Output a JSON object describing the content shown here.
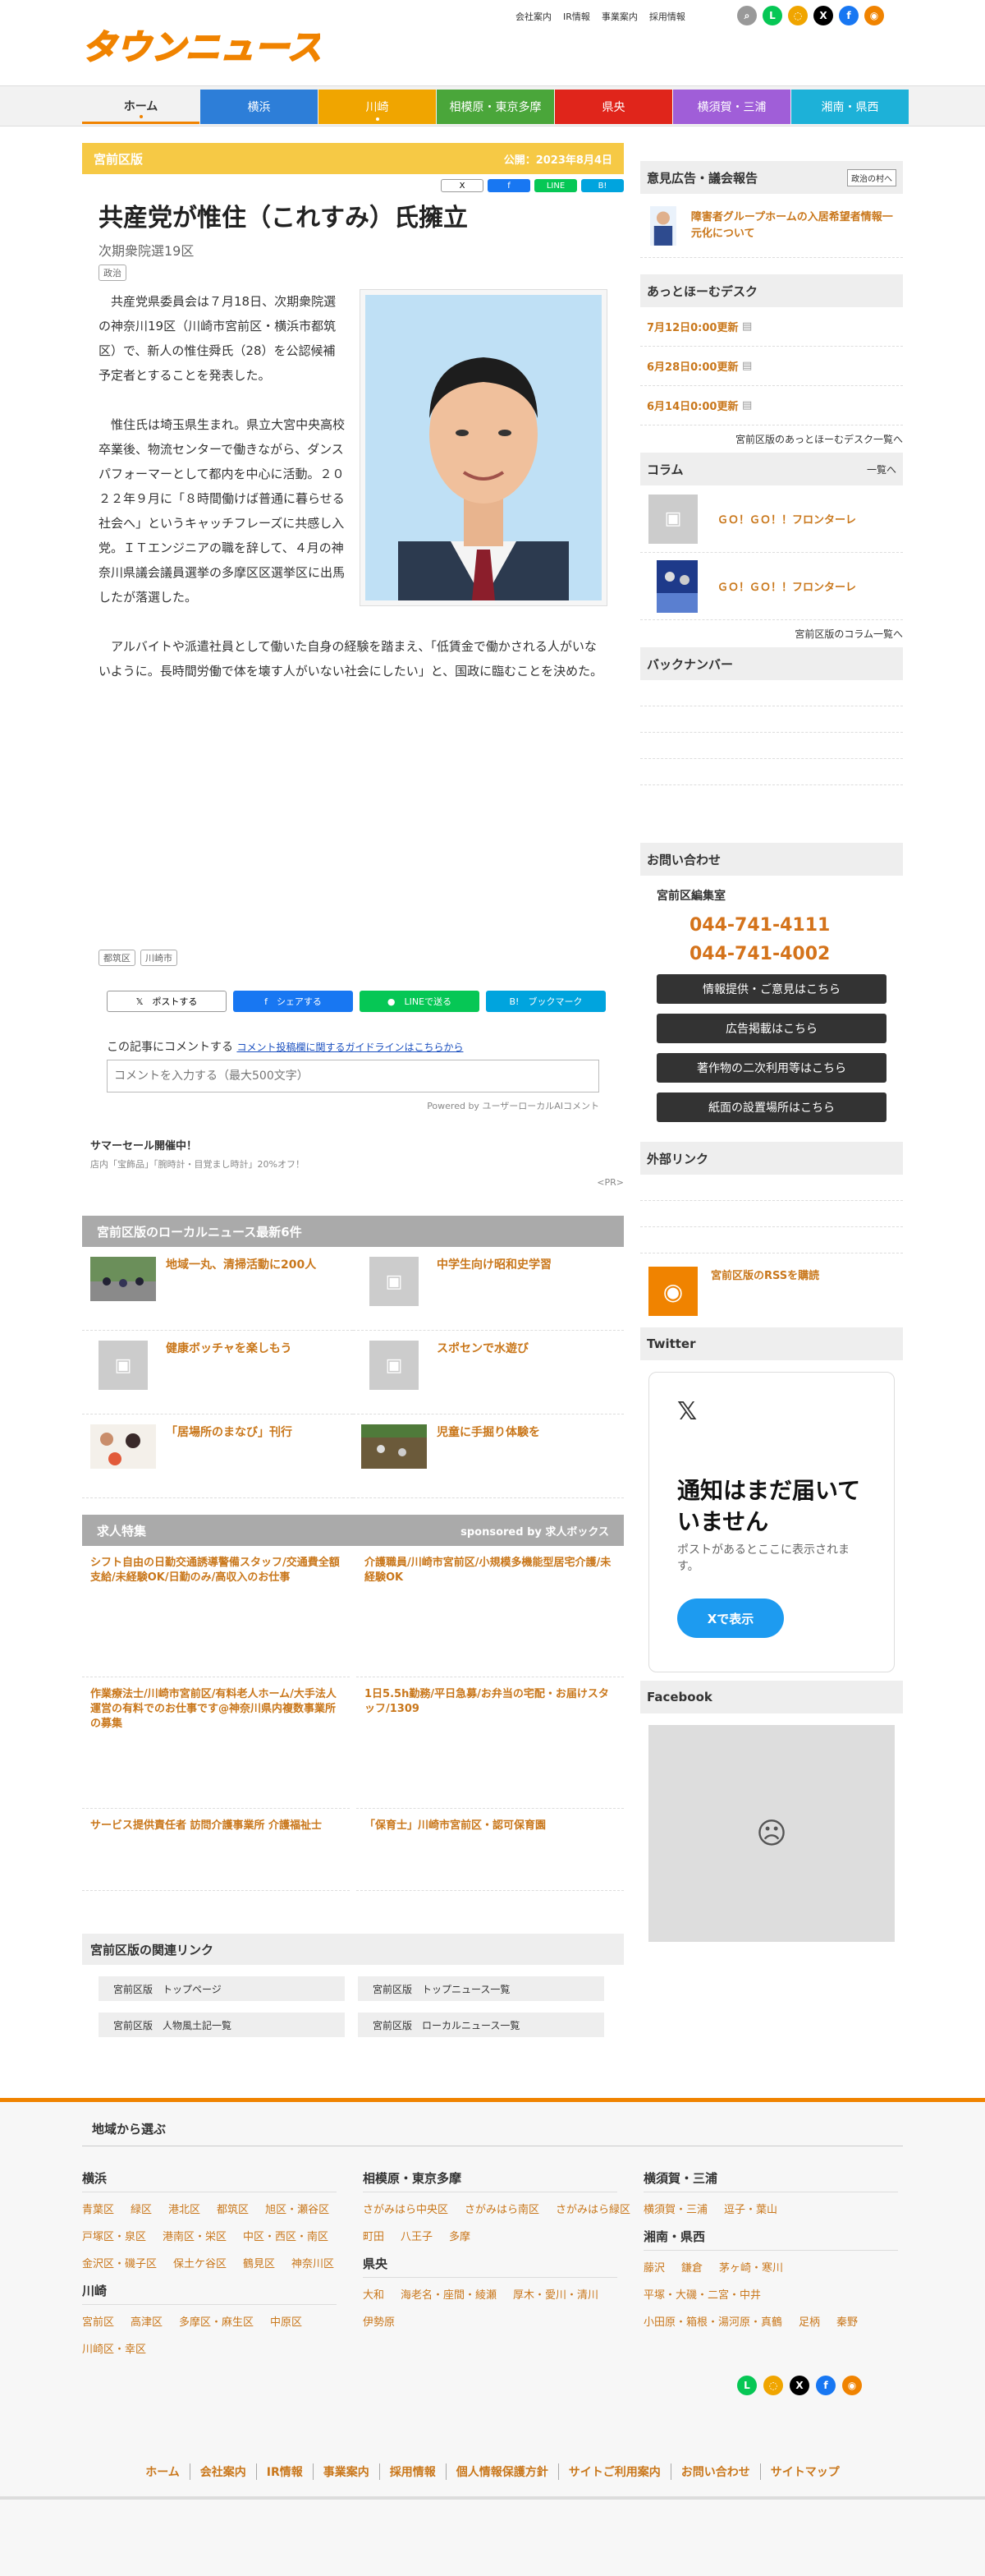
{
  "header": {
    "logo": "タウンニュース",
    "top_links": [
      "会社案内",
      "IR情報",
      "事業案内",
      "採用情報"
    ],
    "icons": [
      "search-icon",
      "line-icon",
      "note-icon",
      "x-icon",
      "facebook-icon",
      "rss-icon"
    ]
  },
  "nav": {
    "items": [
      {
        "label": "ホーム",
        "color": "#f2f2f2"
      },
      {
        "label": "横浜",
        "color": "#2d7ed8"
      },
      {
        "label": "川崎",
        "color": "#f0a500"
      },
      {
        "label": "相模原・東京多摩",
        "color": "#4aa63a"
      },
      {
        "label": "県央",
        "color": "#e0251b"
      },
      {
        "label": "横須賀・三浦",
        "color": "#a05ed8"
      },
      {
        "label": "湘南・県西",
        "color": "#1db1d8"
      }
    ]
  },
  "article": {
    "edition": "宮前区版",
    "date": "公開：2023年8月4日",
    "share_mini": [
      "X",
      "f",
      "LINE",
      "B!"
    ],
    "title": "共産党が惟住（これすみ）氏擁立",
    "subtitle": "次期衆院選19区",
    "category": "政治",
    "paragraphs": [
      "共産党県委員会は７月18日、次期衆院選の神奈川19区（川崎市宮前区・横浜市都筑区）で、新人の惟住舜氏（28）を公認候補予定者とすることを発表した。",
      "惟住氏は埼玉県生まれ。県立大宮中央高校卒業後、物流センターで働きながら、ダンスパフォーマーとして都内を中心に活動。２０２２年９月に「８時間働けば普通に暮らせる社会へ」というキャッチフレーズに共感し入党。ＩＴエンジニアの職を辞して、４月の神奈川県議会議員選挙の多摩区区選挙区に出馬したが落選した。",
      "アルバイトや派遣社員として働いた自身の経験を踏まえ、「低賃金で働かされる人がいないように。長時間労働で体を壊す人がいない社会にしたい」と、国政に臨むことを決めた。"
    ],
    "tags": [
      "都筑区",
      "川崎市"
    ],
    "share_buttons": [
      "ポストする",
      "シェアする",
      "LINEで送る",
      "ブックマーク"
    ],
    "comment_label": "この記事にコメントする",
    "comment_link": "コメント投稿欄に関するガイドラインはこちらから",
    "comment_placeholder": "コメントを入力する（最大500文字）",
    "powered": "Powered by ユーザーローカルAIコメント"
  },
  "promo": {
    "title": "サマーセール開催中！",
    "text": "店内「宝飾品」「腕時計・目覚まし時計」20%オフ！",
    "pr": "<PR>"
  },
  "local_news": {
    "heading": "宮前区版のローカルニュース最新6件",
    "items": [
      {
        "title": "地域一丸、清掃活動に200人",
        "img": true
      },
      {
        "title": "中学生向け昭和史学習",
        "img": false
      },
      {
        "title": "健康ボッチャを楽しもう",
        "img": false
      },
      {
        "title": "スポセンで水遊び",
        "img": false
      },
      {
        "title": "「居場所のまなび」刊行",
        "img": true
      },
      {
        "title": "児童に手掘り体験を",
        "img": true
      }
    ]
  },
  "jobs": {
    "heading": "求人特集",
    "sponsor": "sponsored by 求人ボックス",
    "items": [
      "シフト自由の日勤交通誘導警備スタッフ/交通費全額支給/未経験OK/日勤のみ/高収入のお仕事",
      "介護職員/川崎市宮前区/小規模多機能型居宅介護/未経験OK",
      "作業療法士/川崎市宮前区/有料老人ホーム/大手法人運営の有料でのお仕事です@神奈川県内複数事業所の募集",
      "1日5.5h勤務/平日急募/お弁当の宅配・お届けスタッフ/1309",
      "サービス提供責任者 訪問介護事業所 介護福祉士",
      "「保育士」川崎市宮前区・認可保育園"
    ]
  },
  "related": {
    "heading": "宮前区版の関連リンク",
    "links": [
      "宮前区版　トップページ",
      "宮前区版　トップニュース一覧",
      "宮前区版　人物風土記一覧",
      "宮前区版　ローカルニュース一覧"
    ]
  },
  "sidebar": {
    "opinion_heading": "意見広告・議会報告",
    "opinion_badge": "政治の村へ",
    "opinion_text": "障害者グループホームの入居希望者情報一元化について",
    "athome_heading": "あっとほーむデスク",
    "athome_items": [
      "7月12日0:00更新",
      "6月28日0:00更新",
      "6月14日0:00更新"
    ],
    "athome_more": "宮前区版のあっとほーむデスク一覧へ",
    "column_heading": "コラム",
    "column_more_top": "一覧へ",
    "column_items": [
      "ＧＯ！ＧＯ！！フロンターレ",
      "ＧＯ！ＧＯ！！フロンターレ"
    ],
    "column_more": "宮前区版のコラム一覧へ",
    "backnumber_heading": "バックナンバー",
    "contact_heading": "お問い合わせ",
    "contact_office": "宮前区編集室",
    "tel": "044-741-4111",
    "fax": "044-741-4002",
    "buttons": [
      "情報提供・ご意見はこちら",
      "広告掲載はこちら",
      "著作物の二次利用等はこちら",
      "紙面の設置場所はこちら"
    ],
    "external_heading": "外部リンク",
    "rss_text": "宮前区版のRSSを購読",
    "twitter_heading": "Twitter",
    "tw_title": "通知はまだ届いていません",
    "tw_text": "ポストがあるとここに表示されます。",
    "tw_button": "Xで表示",
    "facebook_heading": "Facebook"
  },
  "footer": {
    "heading": "地域から選ぶ",
    "col1": [
      {
        "title": "横浜",
        "links": [
          "青葉区",
          "緑区",
          "港北区",
          "都筑区",
          "旭区・瀬谷区",
          "戸塚区・泉区",
          "港南区・栄区",
          "中区・西区・南区",
          "金沢区・磯子区",
          "保土ケ谷区",
          "鶴見区",
          "神奈川区"
        ]
      },
      {
        "title": "川崎",
        "links": [
          "宮前区",
          "高津区",
          "多摩区・麻生区",
          "中原区",
          "川崎区・幸区"
        ]
      }
    ],
    "col2": [
      {
        "title": "相模原・東京多摩",
        "links": [
          "さがみはら中央区",
          "さがみはら南区",
          "さがみはら緑区",
          "町田",
          "八王子",
          "多摩"
        ]
      },
      {
        "title": "県央",
        "links": [
          "大和",
          "海老名・座間・綾瀬",
          "厚木・愛川・清川",
          "伊勢原"
        ]
      }
    ],
    "col3": [
      {
        "title": "横須賀・三浦",
        "links": [
          "横須賀・三浦",
          "逗子・葉山"
        ]
      },
      {
        "title": "湘南・県西",
        "links": [
          "藤沢",
          "鎌倉",
          "茅ヶ崎・寒川",
          "平塚・大磯・二宮・中井",
          "小田原・箱根・湯河原・真鶴",
          "足柄",
          "秦野"
        ]
      }
    ],
    "bottom_links": [
      "ホーム",
      "会社案内",
      "IR情報",
      "事業案内",
      "採用情報",
      "個人情報保護方針",
      "サイトご利用案内",
      "お問い合わせ",
      "サイトマップ"
    ]
  }
}
